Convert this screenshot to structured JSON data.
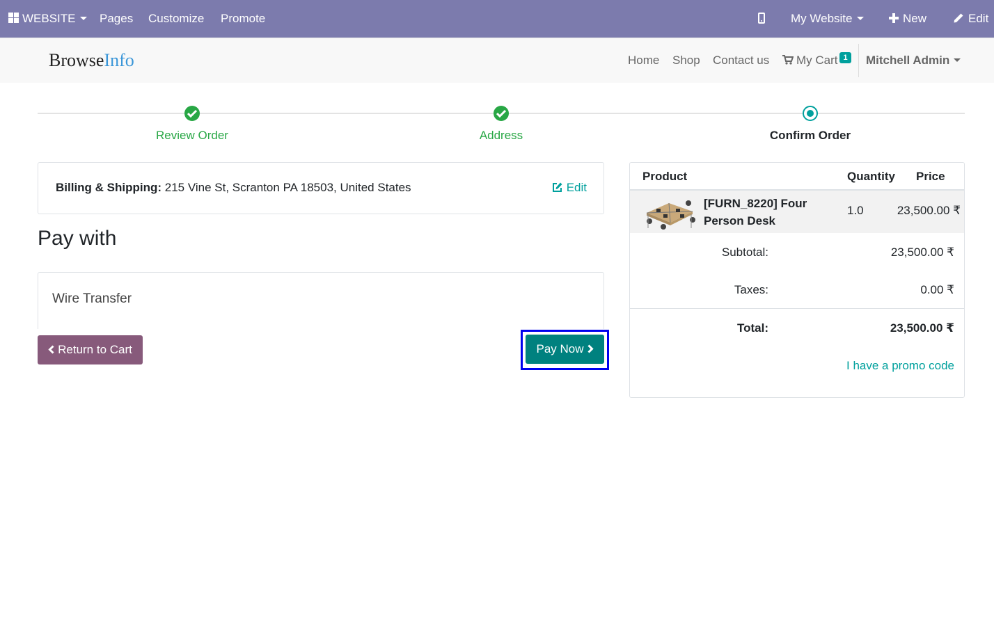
{
  "admin_bar": {
    "website_label": "WEBSITE",
    "pages_label": "Pages",
    "customize_label": "Customize",
    "promote_label": "Promote",
    "site_selector_label": "My Website",
    "new_label": "New",
    "edit_label": "Edit"
  },
  "header": {
    "logo_part1": "Browse",
    "logo_part2": "Info",
    "nav": [
      "Home",
      "Shop",
      "Contact us"
    ],
    "cart_label": "My Cart",
    "cart_count": "1",
    "user_name": "Mitchell Admin"
  },
  "wizard": {
    "steps": [
      {
        "label": "Review Order",
        "state": "done"
      },
      {
        "label": "Address",
        "state": "done"
      },
      {
        "label": "Confirm Order",
        "state": "current"
      }
    ]
  },
  "billing": {
    "label": "Billing & Shipping:",
    "address": "215 Vine St, Scranton PA 18503, United States",
    "edit_label": "Edit"
  },
  "payment": {
    "heading": "Pay with",
    "methods": [
      "Wire Transfer"
    ],
    "return_label": "Return to Cart",
    "pay_label": "Pay Now"
  },
  "summary": {
    "columns": {
      "product": "Product",
      "quantity": "Quantity",
      "price": "Price"
    },
    "items": [
      {
        "name": "[FURN_8220] Four Person Desk",
        "quantity": "1.0",
        "price": "23,500.00 ₹"
      }
    ],
    "subtotal_label": "Subtotal:",
    "subtotal_value": "23,500.00 ₹",
    "taxes_label": "Taxes:",
    "taxes_value": "0.00 ₹",
    "total_label": "Total:",
    "total_value": "23,500.00 ₹",
    "promo_label": "I have a promo code"
  },
  "colors": {
    "admin_bar": "#7c7bad",
    "primary": "#00a09d",
    "pay_button": "#00817f",
    "return_button": "#875a7b",
    "success": "#28a745",
    "highlight": "#0000ee"
  }
}
